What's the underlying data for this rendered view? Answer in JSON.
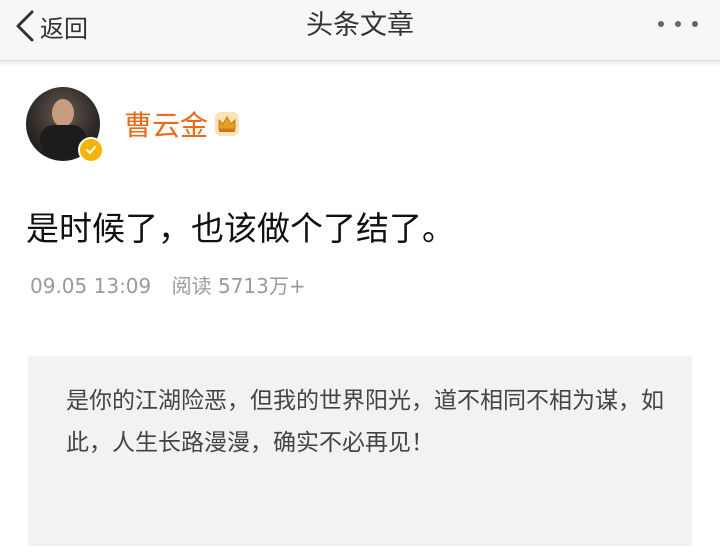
{
  "nav": {
    "back_label": "返回",
    "title": "头条文章",
    "back_icon": "chevron-left-icon",
    "more_icon": "more-dots-icon"
  },
  "author": {
    "name": "曹云金",
    "name_color": "#eb6a18",
    "badge_icon": "crown-icon",
    "verified_icon": "verified-badge-icon"
  },
  "article": {
    "title": "是时候了，也该做个了结了。",
    "time": "09.05 13:09",
    "reads": "阅读 5713万+"
  },
  "quote": {
    "text": "是你的江湖险恶，但我的世界阳光，道不相同不相为谋，如此，人生长路漫漫，确实不必再见！"
  }
}
